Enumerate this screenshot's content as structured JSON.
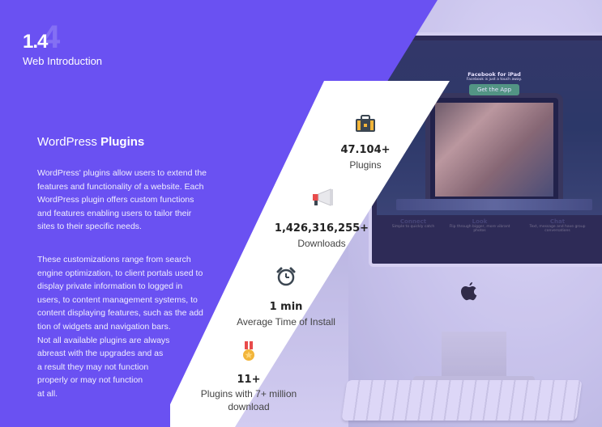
{
  "header": {
    "section_number": "1.4",
    "section_number_ghost": "4",
    "subtitle": "Web Introduction"
  },
  "content": {
    "heading_light": "WordPress ",
    "heading_bold": "Plugins",
    "paragraph1_lines": [
      "WordPress' plugins allow users to extend the",
      "features and functionality of a website. Each",
      "WordPress plugin offers custom functions",
      "and features enabling users to tailor their",
      "sites to their specific needs."
    ],
    "paragraph2_lines": [
      "These customizations range from search",
      "engine optimization, to client portals used to",
      "display private information to logged in",
      "users, to content management systems, to",
      "content displaying features, such as the add",
      "tion of widgets and navigation bars.",
      "Not all available plugins are always",
      "abreast with the upgrades and as",
      "a result they may not function",
      "properly or may not function",
      "at all."
    ]
  },
  "stats": [
    {
      "icon": "briefcase-icon",
      "value": "47.104+",
      "label": "Plugins"
    },
    {
      "icon": "megaphone-icon",
      "value": "1,426,316,255+",
      "label": "Downloads"
    },
    {
      "icon": "alarm-clock-icon",
      "value": "1 min",
      "label": "Average Time of Install"
    },
    {
      "icon": "medal-icon",
      "value": "11+",
      "label_lines": [
        "Plugins with 7+ million",
        "download"
      ]
    }
  ],
  "screen": {
    "fb_title": "Facebook for iPad",
    "fb_sub": "Facebook is just a touch away.",
    "fb_button": "Get the App",
    "features": [
      {
        "title": "Connect",
        "sub": "Simple to quickly catch"
      },
      {
        "title": "Look",
        "sub": "Flip through bigger, more vibrant photos"
      },
      {
        "title": "Chat",
        "sub": "Text, message and have group conversations"
      }
    ]
  },
  "colors": {
    "brand_purple": "#6a51f2",
    "white": "#ffffff",
    "text_dark": "#222222"
  }
}
